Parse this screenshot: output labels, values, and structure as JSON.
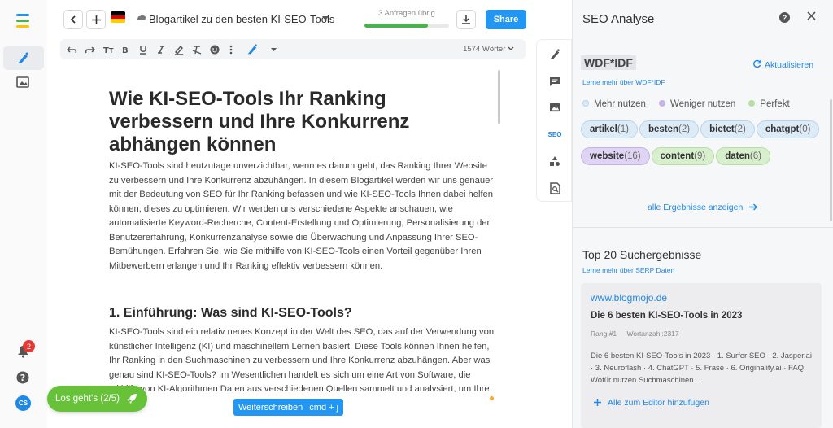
{
  "colors": {
    "accent": "#2196f3",
    "green": "#67c23a"
  },
  "sidebar": {
    "notifications_count": "2",
    "avatar_initials": "CS"
  },
  "header": {
    "document_title": "Blogartikel zu den besten KI-SEO-Tools",
    "quota_label": "3 Anfragen übrig",
    "quota_fraction": 0.75,
    "share_label": "Share"
  },
  "toolbar": {
    "word_count": "1574 Wörter"
  },
  "editor": {
    "h1": "Wie KI-SEO-Tools Ihr Ranking verbessern und Ihre Konkurrenz abhängen können",
    "p1": "KI-SEO-Tools sind heutzutage unverzichtbar, wenn es darum geht, das Ranking Ihrer Website zu verbessern und Ihre Konkurrenz abzuhängen. In diesem Blogartikel werden wir uns genauer mit der Bedeutung von SEO für Ihr Ranking befassen und wie KI-SEO-Tools Ihnen dabei helfen können, dieses zu optimieren. Wir werden uns verschiedene Aspekte anschauen, wie automatisierte Keyword-Recherche, Content-Erstellung und Optimierung, Personalisierung der Benutzererfahrung, Konkurrenzanalyse sowie die Überwachung und Anpassung Ihrer SEO-Bemühungen. Erfahren Sie, wie Sie mithilfe von KI-SEO-Tools einen Vorteil gegenüber Ihren Mitbewerbern erlangen und Ihr Ranking effektiv verbessern können.",
    "h2": "1. Einführung: Was sind KI-SEO-Tools?",
    "p2": "KI-SEO-Tools sind ein relativ neues Konzept in der Welt des SEO, das auf der Verwendung von künstlicher Intelligenz (KI) und maschinellem Lernen basiert. Diese Tools können Ihnen helfen, Ihr Ranking in den Suchmaschinen zu verbessern und Ihre Konkurrenz abzuhängen. Aber was genau sind KI-SEO-Tools? Im Wesentlichen handelt es sich um eine Art von Software, die mithilfe von KI-Algorithmen Daten aus verschiedenen Quellen sammelt und analysiert, um Ihre SEO-Bemühungen zu optimieren. Das kann alles von der Keyword-Recherche bis zur Überwachung Ihrer Backlinks umfassen. Indem Sie diese Tools"
  },
  "floating": {
    "onboarding_label": "Los geht's (2/5)",
    "continue_label": "Weiterschreiben",
    "continue_shortcut": "cmd + j"
  },
  "tools": {
    "seo_label": "SEO"
  },
  "seo_panel": {
    "title": "SEO Analyse",
    "wdf_label": "WDF*IDF",
    "refresh_label": "Aktualisieren",
    "learn_wdf": "Lerne mehr über WDF*IDF",
    "legend": {
      "more": "Mehr nutzen",
      "less": "Weniger nutzen",
      "perfect": "Perfekt"
    },
    "keywords": [
      {
        "word": "artikel",
        "count": "(1)",
        "status": "more"
      },
      {
        "word": "besten",
        "count": "(2)",
        "status": "more"
      },
      {
        "word": "bietet",
        "count": "(2)",
        "status": "more"
      },
      {
        "word": "chatgpt",
        "count": "(0)",
        "status": "more"
      },
      {
        "word": "website",
        "count": "(16)",
        "status": "less"
      },
      {
        "word": "content",
        "count": "(9)",
        "status": "perfect"
      },
      {
        "word": "daten",
        "count": "(6)",
        "status": "perfect"
      }
    ],
    "all_results_label": "alle Ergebnisse anzeigen",
    "top20_title": "Top 20 Suchergebnisse",
    "learn_serp": "Lerne mehr über SERP Daten",
    "result": {
      "url": "www.blogmojo.de",
      "title": "Die 6 besten KI-SEO-Tools in 2023",
      "rank": "Rang:#1",
      "wordcount": "Wortanzahl:2317",
      "description": "Die 6 besten KI-SEO-Tools in 2023 · 1. Surfer SEO · 2. Jasper.ai · 3. Neuroflash · 4. ChatGPT · 5. Frase · 6. Originality.ai · FAQ. Wofür nutzen Suchmaschinen ...",
      "add_all_label": "Alle zum Editor hinzufügen"
    }
  }
}
